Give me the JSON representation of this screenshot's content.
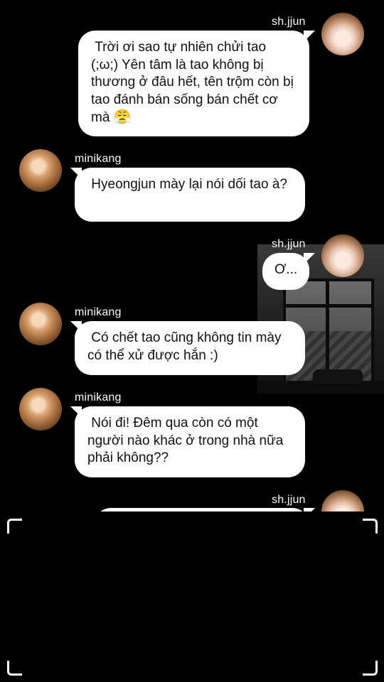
{
  "messages": [
    {
      "sender": "sh.jjun",
      "text": " Trời ơi sao tự nhiên chửi tao (;ω;) Yên tâm là tao không bị thương ở đâu hết, tên trộm còn bị tao đánh bán sống bán chết cơ mà",
      "emoji": "😤"
    },
    {
      "sender": "minikang",
      "text": " Hyeongjun mày lại nói dối tao à?"
    },
    {
      "sender": "sh.jjun",
      "text": "Ơ..."
    },
    {
      "sender": "minikang",
      "text": " Có chết tao cũng không tin mày có thể xử được hắn :)"
    },
    {
      "sender": "minikang",
      "text": " Nói đi! Đêm qua còn có một người nào khác ở trong nhà nữa phải không??"
    },
    {
      "sender": "sh.jjun",
      "text": ""
    }
  ]
}
